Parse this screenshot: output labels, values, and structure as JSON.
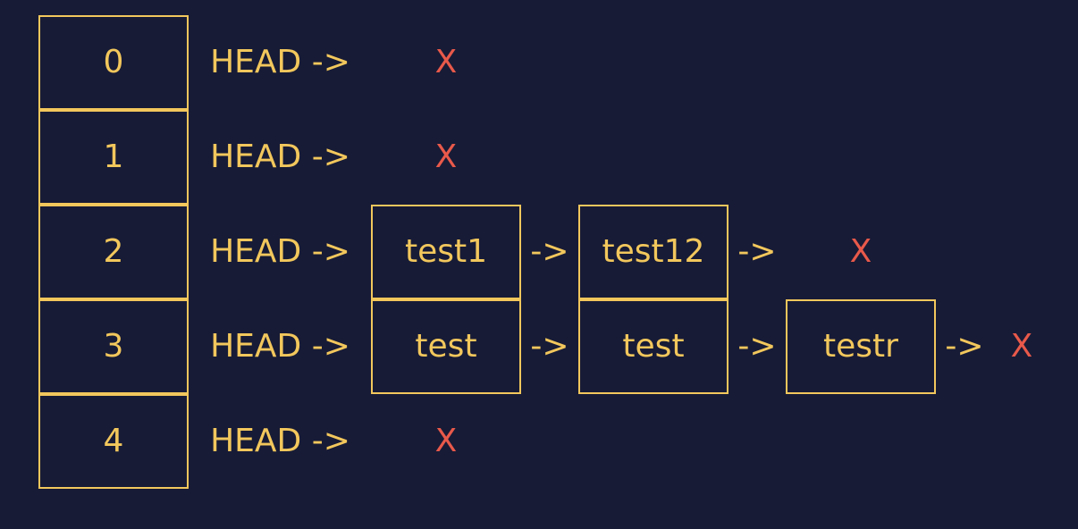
{
  "theme": {
    "background": "#171b36",
    "accent": "#f2c75c",
    "null_color": "#e8594a"
  },
  "head_label": "HEAD ->",
  "arrow_label": "->",
  "null_label": "X",
  "buckets": [
    {
      "index": "0",
      "nodes": []
    },
    {
      "index": "1",
      "nodes": []
    },
    {
      "index": "2",
      "nodes": [
        "test1",
        "test12"
      ]
    },
    {
      "index": "3",
      "nodes": [
        "test",
        "test",
        "testr"
      ]
    },
    {
      "index": "4",
      "nodes": []
    }
  ]
}
